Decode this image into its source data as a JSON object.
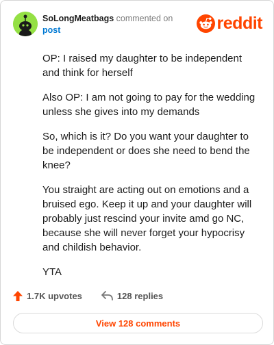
{
  "comment": {
    "username": "SoLongMeatbags",
    "action_text": "commented on",
    "post_link": "post",
    "paragraphs": [
      "OP: I raised my daughter to be independent and think for herself",
      "Also OP: I am not going to pay for the wedding unless she gives into my demands",
      "So, which is it? Do you want your daughter to be independent or does she need to bend the knee?",
      "You straight are acting out on emotions and a bruised ego. Keep it up and your daughter will probably just rescind your invite amd go NC, because she will never forget your hypocrisy and childish behavior.",
      "YTA"
    ]
  },
  "brand": {
    "name": "reddit",
    "color": "#ff4500"
  },
  "stats": {
    "upvotes": "1.7K upvotes",
    "replies": "128 replies"
  },
  "view_button": {
    "label": "View 128 comments"
  },
  "icons": {
    "avatar": "snoo-avatar-icon",
    "logo": "reddit-snoo-icon",
    "upvote": "upvote-arrow-icon",
    "reply": "reply-arrow-icon"
  },
  "colors": {
    "accent": "#ff4500",
    "link": "#0079d3",
    "avatar_bg": "#94e044"
  }
}
